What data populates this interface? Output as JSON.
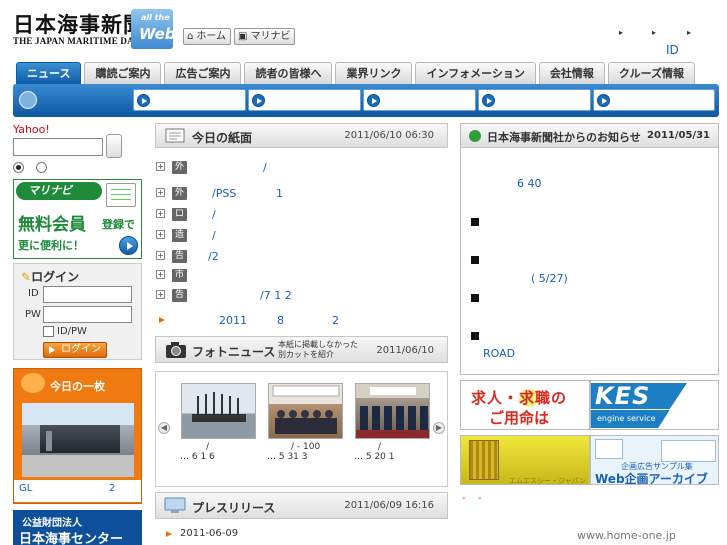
{
  "header": {
    "logo_jp": "日本海事新聞",
    "logo_en": "THE JAPAN MARITIME DAILY",
    "logo_web_a": "all the",
    "logo_web_b": "Web",
    "home_label": "ホーム",
    "marinavi_label": "マリナビ",
    "id_link": "ID"
  },
  "tabs": [
    "ニュース",
    "購読ご案内",
    "広告ご案内",
    "読者の皆様へ",
    "業界リンク",
    "インフォメーション",
    "会社情報",
    "クルーズ情報"
  ],
  "left": {
    "yahoo_label": "Yahoo!",
    "banner": {
      "logo": "マリナビ",
      "free": "無料会員",
      "reg": "登録で",
      "more": "更に便利に！"
    },
    "login": {
      "title": "ログイン",
      "id_label": "ID",
      "pw_label": "PW",
      "save_label": "ID/PW",
      "button": "ログイン"
    },
    "today": {
      "title": "今日の一枚",
      "caption_a": "GL",
      "caption_b": "2"
    },
    "center": {
      "line1": "公益財団法人",
      "line2": "日本海事センター"
    }
  },
  "paper": {
    "title": "今日の紙面",
    "date": "2011/06/10 06:30",
    "rows": [
      {
        "badge": "外航",
        "text": "/"
      },
      {
        "badge": "外航",
        "text": "/PSS",
        "text2": "1"
      },
      {
        "badge": "ロジ",
        "text": "/"
      },
      {
        "badge": "造船",
        "text": "/"
      },
      {
        "badge": "告知",
        "text": "/2"
      },
      {
        "badge": "市況",
        "text": ""
      },
      {
        "badge": "告知",
        "text": "/7 1 2"
      }
    ],
    "footer": {
      "a": "2011",
      "b": "8",
      "c": "2"
    }
  },
  "photo": {
    "title": "フォトニュース",
    "note1": "本紙に掲載しなかった",
    "note2": "別カットを紹介",
    "date": "2011/06/10",
    "captions": [
      {
        "a": "/",
        "b": "… 6 1  6"
      },
      {
        "a": "/ -    100",
        "b": "… 5 31  3"
      },
      {
        "a": "/",
        "b": "… 5 20  1"
      }
    ]
  },
  "press": {
    "title": "プレスリリース",
    "date": "2011/06/09 16:16",
    "item_date": "2011-06-09"
  },
  "notice": {
    "title": "日本海事新聞社からのお知らせ",
    "date": "2011/05/31",
    "t1": "6 40",
    "t2": "( 5/27)",
    "t3": "ROAD"
  },
  "ads": {
    "job1": "求人・求職の",
    "job2": "ご用命は",
    "kes": "KES",
    "kes_sub": "engine service",
    "yellow_sub": "エムエスシー・ジャパン",
    "sample": "企画広告サンプル集",
    "web": "Web企画アーカイブ"
  },
  "footer": {
    "dash1": "-",
    "dash2": "-",
    "homeone": "www.home-one.jp"
  }
}
